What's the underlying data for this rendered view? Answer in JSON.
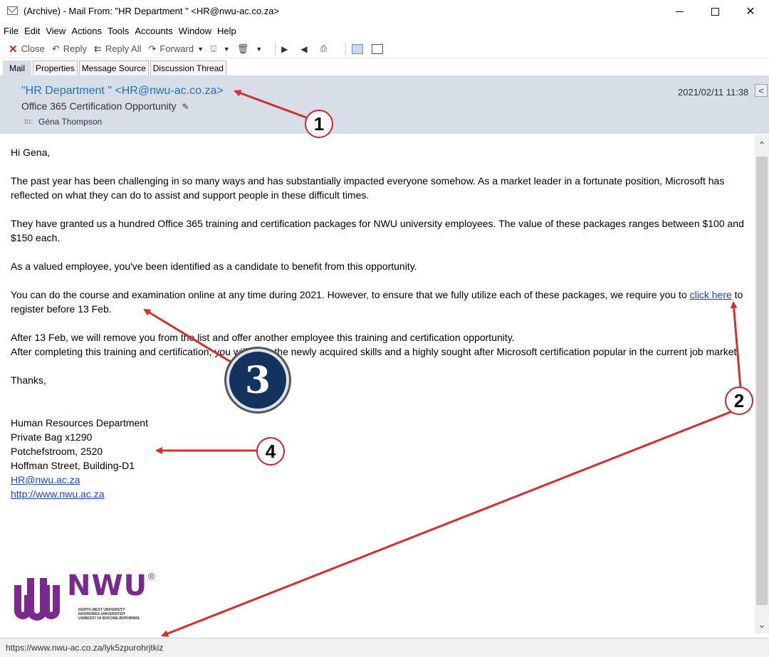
{
  "window": {
    "title": "(Archive) - Mail From: \"HR Department \" <HR@nwu-ac.co.za>",
    "icon": "mail-icon"
  },
  "menu": [
    "File",
    "Edit",
    "View",
    "Actions",
    "Tools",
    "Accounts",
    "Window",
    "Help"
  ],
  "toolbar": {
    "close": "Close",
    "reply": "Reply",
    "reply_all": "Reply All",
    "forward": "Forward"
  },
  "tabs": [
    "Mail",
    "Properties",
    "Message Source",
    "Discussion Thread"
  ],
  "header": {
    "from": "\"HR Department \" <HR@nwu-ac.co.za>",
    "subject": "Office 365 Certification Opportunity",
    "to_label": "to:",
    "to": "Géna Thompson",
    "date": "2021/02/11 11:38"
  },
  "body": {
    "greeting": "Hi Gena,",
    "p1": "The past year has been challenging in so many ways and has substantially impacted everyone somehow. As a market leader in a fortunate position, Microsoft has reflected on what they can do to assist and support people in these difficult times.",
    "p2": "They have granted us a hundred Office 365 training and certification packages for NWU university employees. The value of these packages ranges between $100 and $150 each.",
    "p3": "As a valued employee, you've been identified as a candidate to benefit from this opportunity.",
    "p4_before": "You can do the course and examination online at any time during 2021. However, to ensure that we fully utilize each of these packages, we require you to ",
    "p4_link": "click here",
    "p4_after": " to register before 13 Feb.",
    "p5_line1": "After 13 Feb, we will remove you from the list and offer another employee this training and certification opportunity.",
    "p5_line2": "After completing this training and certification, you will have the newly acquired skills and a highly sought after Microsoft certification popular in the current job market.",
    "thanks": "Thanks,",
    "signature": {
      "dept": "Human Resources Department",
      "line1": "Private Bag x1290",
      "line2": "Potchefstroom, 2520",
      "line3": "Hoffman Street, Building-D1",
      "email": "HR@nwu.ac.za",
      "web": "http://www.nwu.ac.za"
    }
  },
  "logo": {
    "wordmark": "NWU",
    "reg": "®",
    "lines": [
      "NORTH-WEST UNIVERSITY",
      "NOORDWES-UNIVERSITEIT",
      "UNIBESITI YA BOKONE-BOPHIRIMA"
    ]
  },
  "status_bar": {
    "url": "https://www.nwu-ac.co.za/lyk5zpurohrjtkiz"
  },
  "annotations": {
    "c1": "1",
    "c2": "2",
    "c3": "3",
    "c4": "4",
    "arrow_color": "#d32f2f"
  }
}
